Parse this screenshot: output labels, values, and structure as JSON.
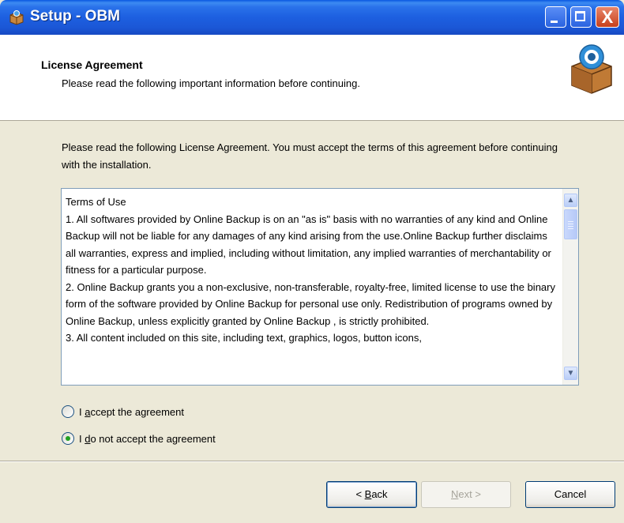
{
  "window": {
    "title": "Setup - OBM",
    "controls": {
      "minimize_icon": "minimize-icon",
      "maximize_icon": "maximize-icon",
      "close_icon": "close-icon",
      "close_glyph": "X"
    }
  },
  "header": {
    "title": "License Agreement",
    "subtitle": "Please read the following important information before continuing.",
    "logo_icon": "setup-box-icon"
  },
  "intro_text": "Please read the following License Agreement. You must accept the terms of this agreement before continuing with the installation.",
  "license": {
    "text": "Terms of Use\n1. All softwares provided by Online Backup is on an \"as is\" basis with no warranties of any kind and Online Backup will not be liable for any damages of any kind arising from the use.Online Backup further disclaims all warranties, express and implied, including without limitation, any implied warranties of merchantability or fitness for a particular purpose.\n2. Online Backup grants you a non-exclusive, non-transferable, royalty-free, limited license to use the binary form of the software provided by Online Backup for personal use only. Redistribution of programs owned by Online Backup, unless explicitly granted by Online Backup , is strictly prohibited.\n3. All content included on this site, including text, graphics, logos, button icons,",
    "scroll_up_glyph": "▲",
    "scroll_down_glyph": "▼"
  },
  "options": {
    "accept": {
      "prefix": "I ",
      "hotkey": "a",
      "rest": "ccept the agreement",
      "selected": false
    },
    "decline": {
      "prefix": "I ",
      "hotkey": "d",
      "rest": "o not accept the agreement",
      "selected": true
    }
  },
  "buttons": {
    "back": {
      "prefix": "< ",
      "hotkey": "B",
      "rest": "ack"
    },
    "next": {
      "prefix": "",
      "hotkey": "N",
      "rest": "ext >",
      "enabled": false
    },
    "cancel": "Cancel"
  },
  "colors": {
    "titlebar": "#1d5fe0",
    "dialog_bg": "#ece9d8",
    "radio_dot": "#21a121"
  }
}
